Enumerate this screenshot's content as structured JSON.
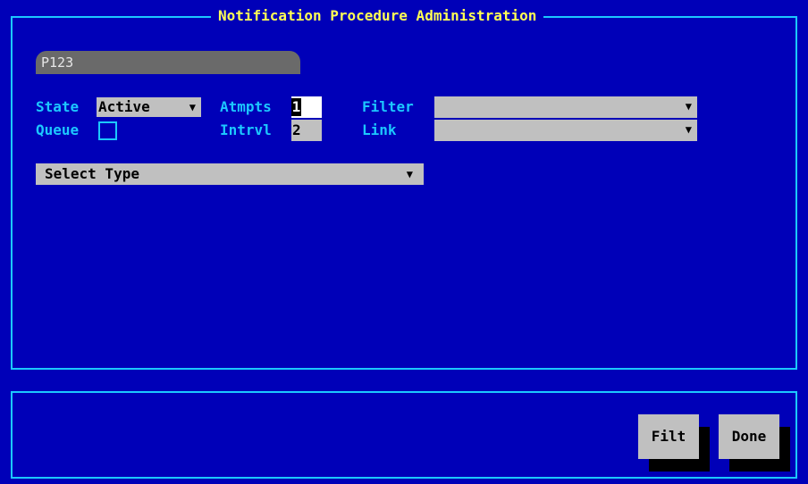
{
  "window": {
    "title": "Notification Procedure Administration",
    "tab_label": "P123"
  },
  "form": {
    "state": {
      "label": "State",
      "value": "Active"
    },
    "queue": {
      "label": "Queue",
      "checked": false
    },
    "atmpts": {
      "label": "Atmpts",
      "value": "1"
    },
    "intrvl": {
      "label": "Intrvl",
      "value": "2"
    },
    "filter": {
      "label": "Filter",
      "value": ""
    },
    "link": {
      "label": "Link",
      "value": ""
    },
    "select_type": {
      "value": "Select Type"
    }
  },
  "buttons": {
    "filt": "Filt",
    "done": "Done"
  },
  "colors": {
    "background": "#0000b8",
    "frame": "#1cc8ff",
    "title": "#ffff55",
    "field": "#c0c0c0"
  }
}
